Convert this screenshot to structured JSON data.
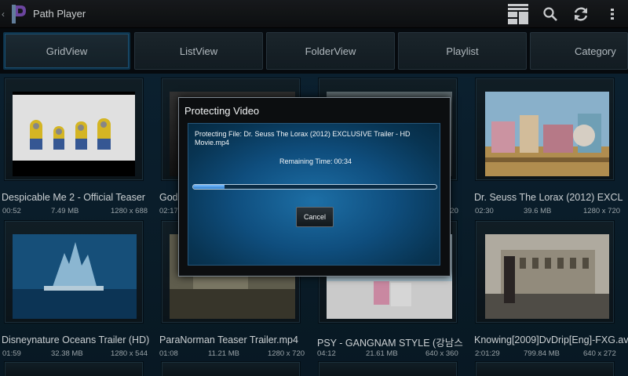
{
  "app": {
    "title": "Path Player"
  },
  "tabs": [
    {
      "label": "GridView"
    },
    {
      "label": "ListView"
    },
    {
      "label": "FolderView"
    },
    {
      "label": "Playlist"
    },
    {
      "label": "Category"
    }
  ],
  "videos": [
    {
      "title": "Despicable Me 2 - Official Teaser",
      "duration": "00:52",
      "size": "7.49 MB",
      "resolution": "1280 x 688"
    },
    {
      "title": "God",
      "duration": "02:17",
      "size": "",
      "resolution": ""
    },
    {
      "title": "",
      "duration": "",
      "size": "",
      "resolution": ""
    },
    {
      "title": "Dr. Seuss The Lorax (2012)  EXCL",
      "duration": "02:30",
      "size": "39.6 MB",
      "resolution": "1280 x 720"
    },
    {
      "title": "Disneynature Oceans Trailer (HD)",
      "duration": "01:59",
      "size": "32.38 MB",
      "resolution": "1280 x 544"
    },
    {
      "title": "ParaNorman Teaser Trailer.mp4",
      "duration": "01:08",
      "size": "11.21 MB",
      "resolution": "1280 x 720"
    },
    {
      "title": "PSY - GANGNAM STYLE (강남스",
      "duration": "04:12",
      "size": "21.61 MB",
      "resolution": "640 x 360"
    },
    {
      "title": "Knowing[2009]DvDrip[Eng]-FXG.av",
      "duration": "2:01:29",
      "size": "799.84 MB",
      "resolution": "640 x 272"
    }
  ],
  "dialog": {
    "title": "Protecting Video",
    "message": "Protecting File: Dr. Seuss The Lorax (2012)  EXCLUSIVE Trailer - HD Movie.mp4",
    "remaining_label": "Remaining Time:",
    "remaining_value": "00:34",
    "progress": 0.13,
    "cancel_label": "Cancel"
  },
  "icons": {
    "logo": "path-player-logo",
    "view": "layout-icon",
    "search": "search-icon",
    "refresh": "refresh-icon",
    "overflow": "overflow-menu-icon"
  },
  "colors": {
    "accent": "#1d6fa6",
    "progress": "#4a9fe8",
    "background": "#0b1822"
  }
}
